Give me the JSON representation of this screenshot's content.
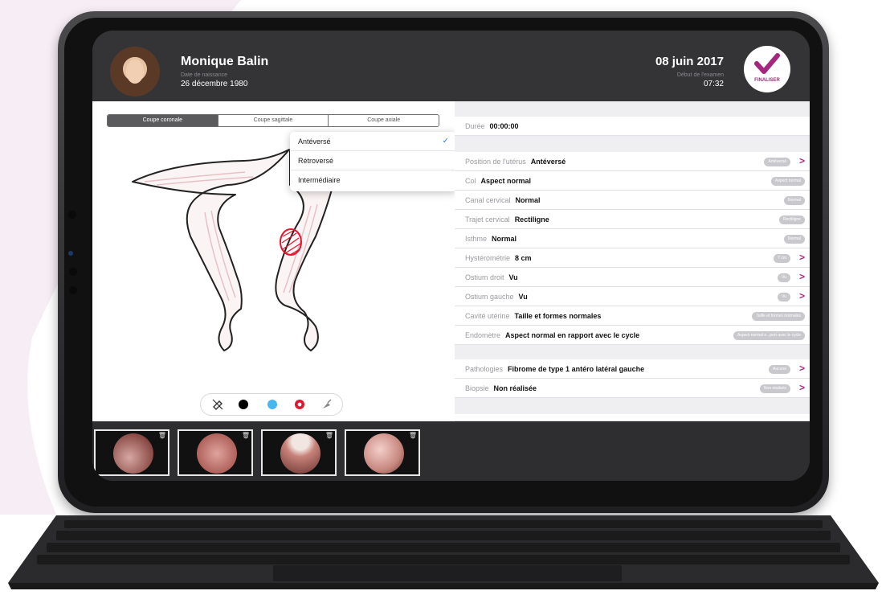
{
  "patient": {
    "name": "Monique Balin",
    "birth_label": "Date de naissance",
    "birth_date": "26 décembre 1980"
  },
  "exam": {
    "date": "08 juin 2017",
    "start_label": "Début de l'examen",
    "start_time": "07:32",
    "finalize_label": "FINALISER"
  },
  "view_tabs": [
    "Coupe coronale",
    "Coupe sagittale",
    "Coupe axiale"
  ],
  "dropdown": {
    "options": [
      "Antéversé",
      "Rétroversé",
      "Intermédiaire"
    ],
    "selected": "Antéversé",
    "check": "✓"
  },
  "duration": {
    "label": "Durée",
    "value": "00:00:00"
  },
  "fields": [
    {
      "label": "Position de l'utérus",
      "value": "Antéversé",
      "pill": "Antéversé",
      "chevron": true
    },
    {
      "label": "Col",
      "value": "Aspect normal",
      "pill": "Aspect normal",
      "chevron": false
    },
    {
      "label": "Canal cervical",
      "value": "Normal",
      "pill": "Normal",
      "chevron": false
    },
    {
      "label": "Trajet cervical",
      "value": "Rectiligne",
      "pill": "Rectiligne",
      "chevron": false
    },
    {
      "label": "Isthme",
      "value": "Normal",
      "pill": "Normal",
      "chevron": false
    },
    {
      "label": "Hystérométrie",
      "value": "8 cm",
      "pill": "7 cm",
      "chevron": true
    },
    {
      "label": "Ostium droit",
      "value": "Vu",
      "pill": "Vu",
      "chevron": true
    },
    {
      "label": "Ostium gauche",
      "value": "Vu",
      "pill": "Vu",
      "chevron": true
    },
    {
      "label": "Cavité utérine",
      "value": "Taille et formes normales",
      "pill": "Taille et formes normales",
      "chevron": false
    },
    {
      "label": "Endomètre",
      "value": "Aspect normal en rapport avec le cycle",
      "pill": "Aspect normal e...port avec le cycle",
      "chevron": false
    }
  ],
  "fields2": [
    {
      "label": "Pathologies",
      "value": "Fibrome de type 1 antéro latéral gauche",
      "pill": "Aucune",
      "chevron": true
    },
    {
      "label": "Biopsie",
      "value": "Non réalisée",
      "pill": "Non réalisée",
      "chevron": true
    }
  ],
  "tool_icons": [
    "eraser-icon",
    "black-pen-icon",
    "blue-pen-icon",
    "red-ring-icon",
    "tool-icon"
  ],
  "colors": {
    "accent": "#a5287f",
    "header_bg": "#343436",
    "blue": "#47b7ef",
    "red": "#e4142c"
  },
  "thumbnails": 4
}
